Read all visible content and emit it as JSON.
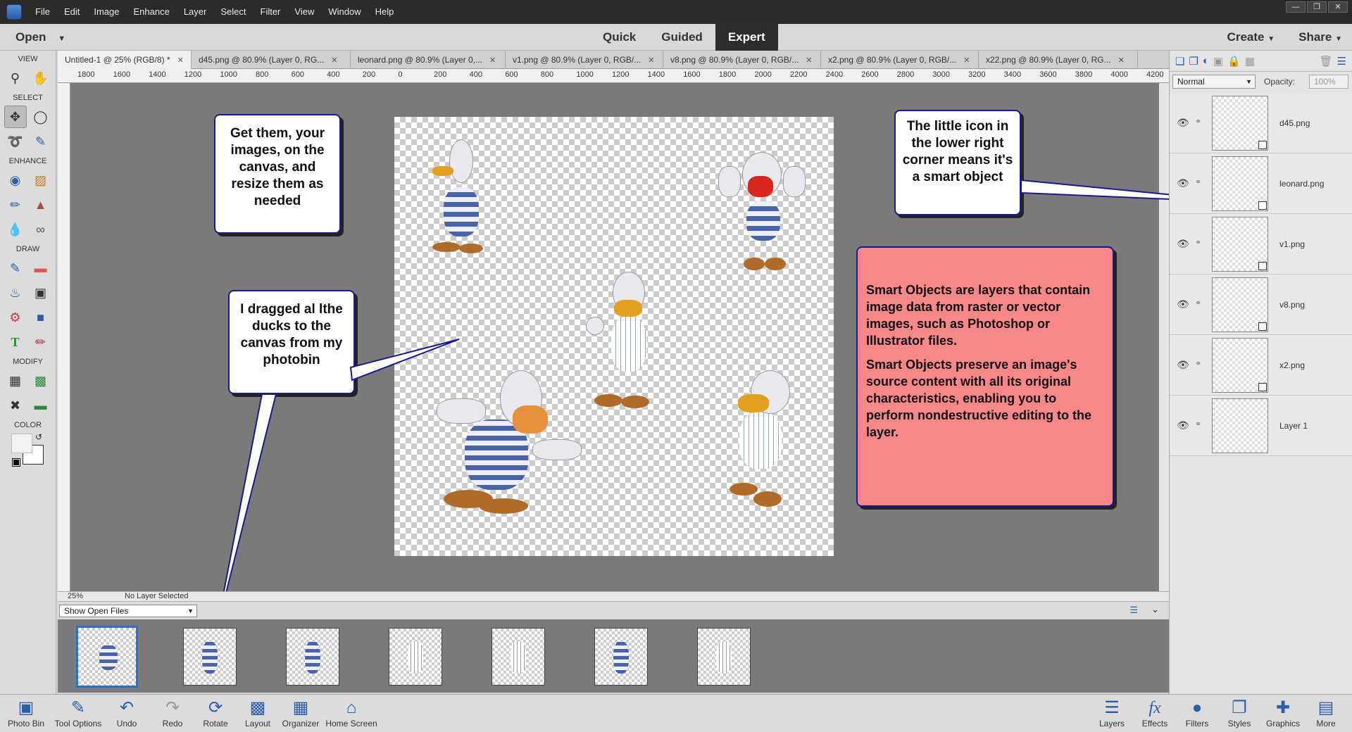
{
  "menubar": {
    "items": [
      "File",
      "Edit",
      "Image",
      "Enhance",
      "Layer",
      "Select",
      "Filter",
      "View",
      "Window",
      "Help"
    ]
  },
  "modebar": {
    "open": "Open",
    "modes": [
      "Quick",
      "Guided",
      "Expert"
    ],
    "active_mode": "Expert",
    "create": "Create",
    "share": "Share"
  },
  "toolbox": {
    "sections": [
      "VIEW",
      "SELECT",
      "ENHANCE",
      "DRAW",
      "MODIFY",
      "COLOR"
    ]
  },
  "tabs": [
    "Untitled-1 @ 25% (RGB/8) *",
    "d45.png @ 80.9% (Layer 0, RG...",
    "leonard.png @ 80.9% (Layer 0,...",
    "v1.png @ 80.9% (Layer 0, RGB/...",
    "v8.png @ 80.9% (Layer 0, RGB/...",
    "x2.png @ 80.9% (Layer 0, RGB/...",
    "x22.png @ 80.9% (Layer 0, RG..."
  ],
  "ruler": [
    "1800",
    "1600",
    "1400",
    "1200",
    "1000",
    "800",
    "600",
    "400",
    "200",
    "0",
    "200",
    "400",
    "600",
    "800",
    "1000",
    "1200",
    "1400",
    "1600",
    "1800",
    "2000",
    "2200",
    "2400",
    "2600",
    "2800",
    "3000",
    "3200",
    "3400",
    "3600",
    "3800",
    "4000",
    "4200"
  ],
  "status": {
    "zoom": "25%",
    "selection": "No Layer Selected"
  },
  "photobin": {
    "show": "Show Open Files",
    "thumb_count": 7
  },
  "layers_panel": {
    "blend_mode": "Normal",
    "opacity_label": "Opacity:",
    "opacity_value": "100%"
  },
  "layers": [
    "d45.png",
    "leonard.png",
    "v1.png",
    "v8.png",
    "x2.png",
    "Layer 1"
  ],
  "callouts": {
    "get_them": "Get them, your images, on the canvas, and resize them as needed",
    "dragged": "I dragged al lthe ducks to the canvas from my photobin",
    "icon": "The little icon in the lower right corner means it's a smart object",
    "smart1": "Smart Objects are layers that contain image data from raster or vector images, such as Photoshop or Illustrator files.",
    "smart2": "Smart Objects preserve an image's source content with all its original characteristics, enabling you to perform nondestructive editing to the layer."
  },
  "taskbar_left": [
    "Photo Bin",
    "Tool Options",
    "Undo",
    "Redo",
    "Rotate",
    "Layout",
    "Organizer",
    "Home Screen"
  ],
  "taskbar_right": [
    "Layers",
    "Effects",
    "Filters",
    "Styles",
    "Graphics",
    "More"
  ],
  "colors": {
    "accent": "#2f6fd0",
    "callout_border": "#1a1a8c",
    "callout_pink": "#f88787"
  }
}
